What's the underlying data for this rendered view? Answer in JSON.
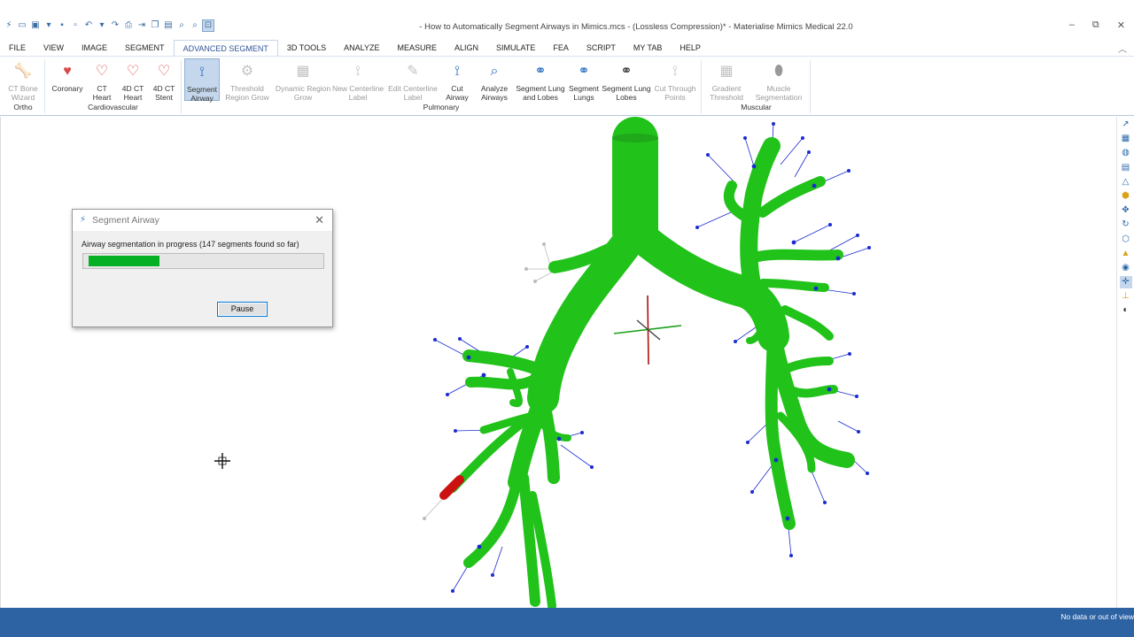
{
  "window": {
    "title": "- How to Automatically Segment Airways in Mimics.mcs -  (Lossless Compression)* - Materialise Mimics Medical 22.0",
    "controls": [
      "–",
      "⧉",
      "✕"
    ]
  },
  "quick_access": [
    "app-logo-icon",
    "new-icon",
    "open-icon",
    "dropdown-icon",
    "save-icon",
    "save-as-icon",
    "undo-icon",
    "dropdown-icon",
    "redo-icon",
    "print-icon",
    "export-icon",
    "copy-icon",
    "paste-icon",
    "zoom-out-icon",
    "zoom-in-icon",
    "zoom-window-icon"
  ],
  "menu": {
    "items": [
      "FILE",
      "VIEW",
      "IMAGE",
      "SEGMENT",
      "ADVANCED SEGMENT",
      "3D TOOLS",
      "ANALYZE",
      "MEASURE",
      "ALIGN",
      "SIMULATE",
      "FEA",
      "SCRIPT",
      "MY TAB",
      "HELP"
    ],
    "active": "ADVANCED SEGMENT"
  },
  "ribbon": {
    "tools": [
      {
        "line1": "CT Bone",
        "line2": "Wizard",
        "icon": "bone-icon",
        "state": "disabled"
      },
      {
        "line1": "Coronary",
        "line2": "",
        "icon": "coronary-heart-icon",
        "state": "normal"
      },
      {
        "line1": "CT",
        "line2": "Heart",
        "icon": "ct-heart-icon",
        "state": "normal"
      },
      {
        "line1": "4D CT",
        "line2": "Heart",
        "icon": "4d-ct-heart-icon",
        "state": "normal"
      },
      {
        "line1": "4D CT",
        "line2": "Stent",
        "icon": "4d-ct-stent-icon",
        "state": "normal"
      },
      {
        "line1": "Segment",
        "line2": "Airway",
        "icon": "segment-airway-icon",
        "state": "selected"
      },
      {
        "line1": "Threshold",
        "line2": "Region Grow",
        "icon": "threshold-region-grow-icon",
        "state": "disabled"
      },
      {
        "line1": "Dynamic Region",
        "line2": "Grow",
        "icon": "dynamic-region-grow-icon",
        "state": "disabled"
      },
      {
        "line1": "New Centerline",
        "line2": "Label",
        "icon": "new-centerline-label-icon",
        "state": "disabled"
      },
      {
        "line1": "Edit Centerline",
        "line2": "Label",
        "icon": "edit-centerline-label-icon",
        "state": "disabled"
      },
      {
        "line1": "Cut",
        "line2": "Airway",
        "icon": "cut-airway-icon",
        "state": "normal"
      },
      {
        "line1": "Analyze",
        "line2": "Airways",
        "icon": "analyze-airways-icon",
        "state": "normal"
      },
      {
        "line1": "Segment Lung",
        "line2": "and Lobes",
        "icon": "segment-lung-lobes-icon",
        "state": "normal"
      },
      {
        "line1": "Segment",
        "line2": "Lungs",
        "icon": "segment-lungs-icon",
        "state": "normal"
      },
      {
        "line1": "Segment Lung",
        "line2": "Lobes",
        "icon": "segment-lung-lobes-2-icon",
        "state": "normal"
      },
      {
        "line1": "Cut Through",
        "line2": "Points",
        "icon": "cut-through-points-icon",
        "state": "disabled"
      },
      {
        "line1": "Gradient",
        "line2": "Threshold",
        "icon": "gradient-threshold-icon",
        "state": "disabled"
      },
      {
        "line1": "Muscle",
        "line2": "Segmentation",
        "icon": "muscle-segmentation-icon",
        "state": "disabled"
      }
    ],
    "groups": [
      "Ortho",
      "Cardiovascular",
      "Pulmonary",
      "Muscular"
    ]
  },
  "dialog": {
    "title": "Segment Airway",
    "message": "Airway segmentation in progress (147 segments found so far)",
    "progress_fraction": 0.31,
    "button_label": "Pause"
  },
  "right_toolbar_icons": [
    "expand-arrow-icon",
    "grid-icon",
    "sphere-icon",
    "stack-icon",
    "triangle-icon",
    "object-icon",
    "move-icon",
    "rotate-icon",
    "cube-icon",
    "cone-icon",
    "eye-icon",
    "crosshair-icon",
    "ruler-icon",
    "contrast-icon"
  ],
  "status": {
    "text": "No data or out of view"
  },
  "colors": {
    "accent": "#2d62a3",
    "progress": "#06b025",
    "airway": "#21c21a",
    "centerline_node": "#1a2ccf",
    "cut_marker": "#cc1111"
  }
}
